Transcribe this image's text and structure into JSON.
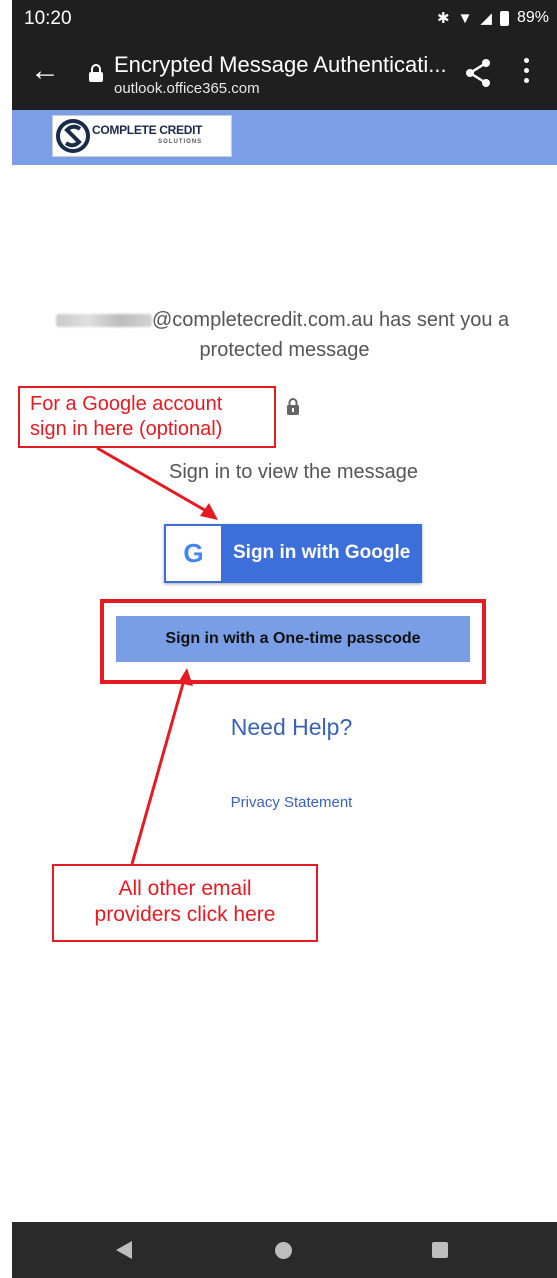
{
  "status_bar": {
    "time": "10:20",
    "battery": "89%"
  },
  "browser": {
    "title": "Encrypted Message Authenticati...",
    "url": "outlook.office365.com"
  },
  "brand": {
    "name": "COMPLETE CREDIT",
    "sub": "SOLUTIONS"
  },
  "message": {
    "sender_suffix": "@completecredit.com.au has sent you a",
    "line2": "protected message",
    "sign_in_prompt": "Sign in to view the message"
  },
  "buttons": {
    "google": "Sign in with Google",
    "google_glyph": "G",
    "otp": "Sign in with a One-time passcode"
  },
  "links": {
    "help": "Need Help?",
    "privacy": "Privacy Statement"
  },
  "annotations": {
    "google_note_line1": "For a Google account",
    "google_note_line2": "sign in here (optional)",
    "other_note_line1": "All other email",
    "other_note_line2": "providers click here"
  },
  "colors": {
    "accent": "#3c6fd9",
    "banner": "#7c9ee6",
    "annotation": "#e41b23",
    "link": "#3a62b6"
  }
}
